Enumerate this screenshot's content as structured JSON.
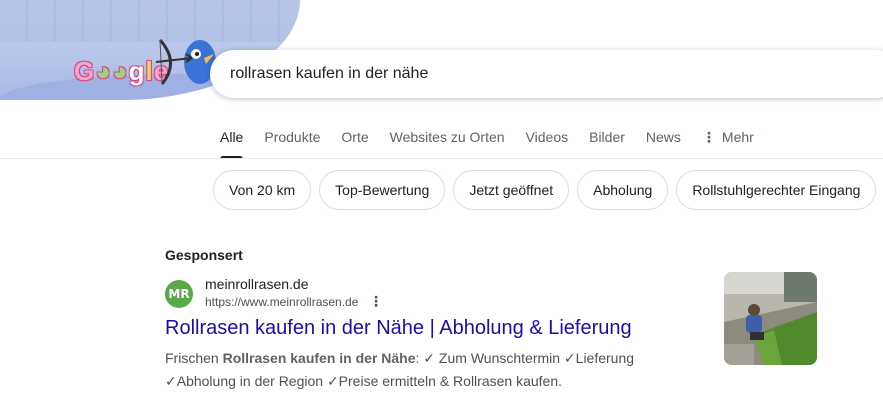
{
  "search": {
    "query": "rollrasen kaufen in der nähe"
  },
  "logo": {
    "parts": [
      "G",
      "o",
      "o",
      "g",
      "l",
      "e"
    ],
    "icon": "doodle-bird-archer"
  },
  "tabs": [
    {
      "label": "Alle",
      "active": true
    },
    {
      "label": "Produkte"
    },
    {
      "label": "Orte"
    },
    {
      "label": "Websites zu Orten"
    },
    {
      "label": "Videos"
    },
    {
      "label": "Bilder"
    },
    {
      "label": "News"
    },
    {
      "label": "Mehr",
      "icon": "more-vert-icon"
    }
  ],
  "chips": [
    {
      "label": "Von 20 km"
    },
    {
      "label": "Top-Bewertung"
    },
    {
      "label": "Jetzt geöffnet"
    },
    {
      "label": "Abholung"
    },
    {
      "label": "Rollstuhlgerechter Eingang"
    }
  ],
  "ad": {
    "sponsored_label": "Gesponsert",
    "favicon_text": "MR",
    "site_name": "meinrollrasen.de",
    "url": "https://www.meinrollrasen.de",
    "title": "Rollrasen kaufen in der Nähe | Abholung & Lieferung",
    "snippet_pre": "Frischen ",
    "snippet_bold": "Rollrasen kaufen in der Nähe",
    "snippet_post": ": ✓ Zum Wunschtermin ✓Lieferung ✓Abholung in der Region ✓Preise ermitteln & Rollrasen kaufen.",
    "thumbnail": "lawn-laying-photo"
  },
  "colors": {
    "link": "#1a0dab",
    "favicon_bg": "#5ba84a",
    "doodle_bg": "#b7c4ea"
  }
}
